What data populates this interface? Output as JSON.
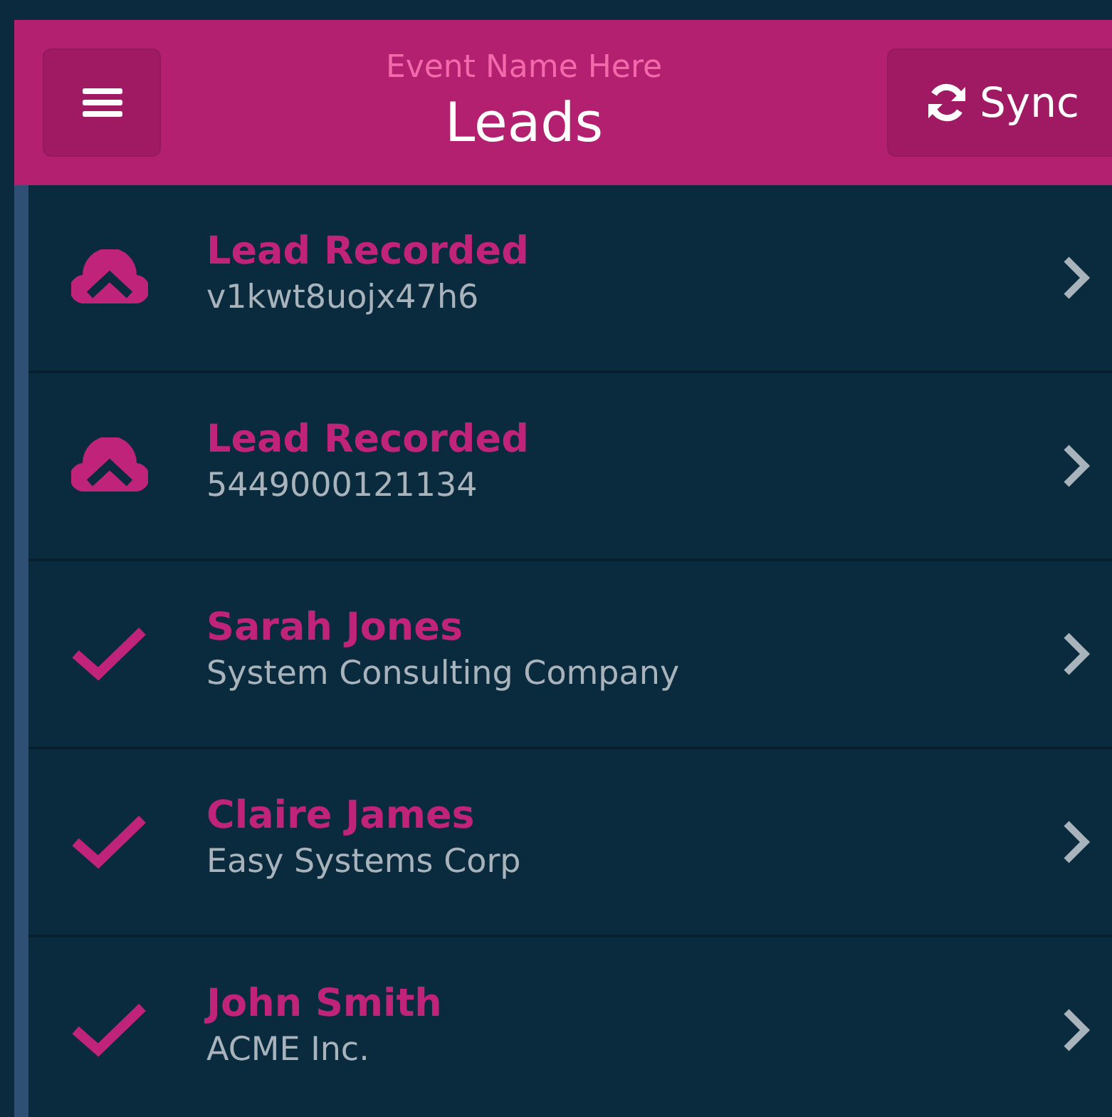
{
  "header": {
    "event_name": "Event Name Here",
    "title": "Leads",
    "sync_label": "Sync"
  },
  "leads": [
    {
      "kind": "pending",
      "title": "Lead Recorded",
      "subtitle": "v1kwt8uojx47h6"
    },
    {
      "kind": "pending",
      "title": "Lead Recorded",
      "subtitle": "5449000121134"
    },
    {
      "kind": "synced",
      "title": "Sarah Jones",
      "subtitle": "System Consulting Company"
    },
    {
      "kind": "synced",
      "title": "Claire James",
      "subtitle": "Easy Systems Corp"
    },
    {
      "kind": "synced",
      "title": "John Smith",
      "subtitle": "ACME Inc."
    }
  ]
}
